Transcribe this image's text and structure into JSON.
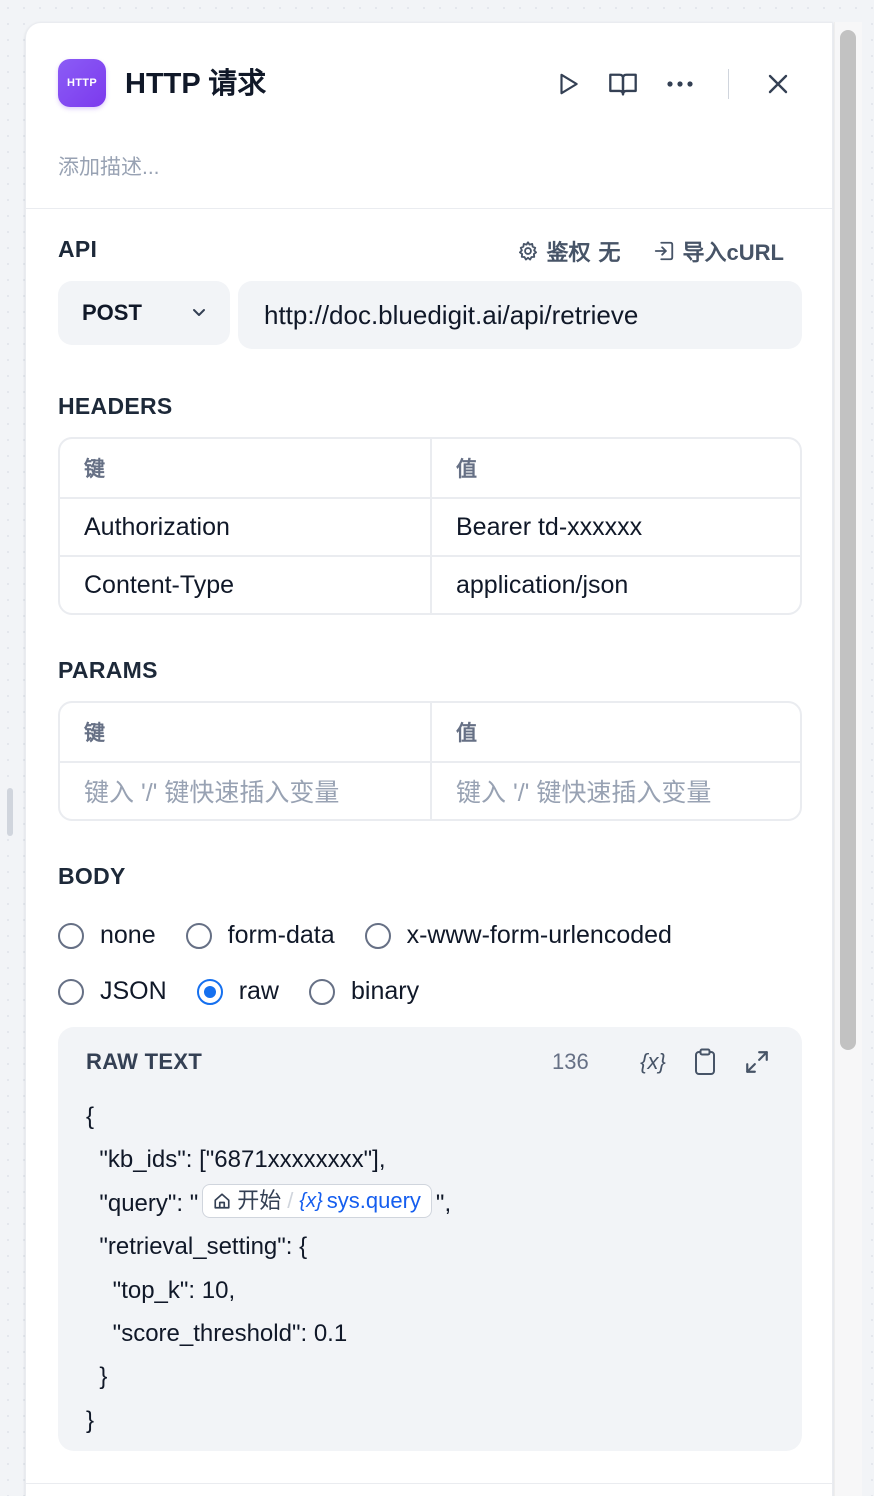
{
  "node": {
    "icon_text": "HTTP",
    "title": "HTTP 请求",
    "description_placeholder": "添加描述..."
  },
  "header_actions": [
    "run-icon",
    "docs-book-icon",
    "more-icon",
    "close-icon"
  ],
  "api": {
    "section_title": "API",
    "auth_label": "鉴权",
    "auth_value": "无",
    "import_curl_label": "导入cURL",
    "method": "POST",
    "url": "http://doc.bluedigit.ai/api/retrieve"
  },
  "headers": {
    "section_title": "HEADERS",
    "key_header": "键",
    "value_header": "值",
    "rows": [
      {
        "key": "Authorization",
        "value": "Bearer td-xxxxxx"
      },
      {
        "key": "Content-Type",
        "value": "application/json"
      }
    ]
  },
  "params": {
    "section_title": "PARAMS",
    "key_header": "键",
    "value_header": "值",
    "key_placeholder": "键入 '/' 键快速插入变量",
    "value_placeholder": "键入 '/' 键快速插入变量"
  },
  "body": {
    "section_title": "BODY",
    "options": [
      "none",
      "form-data",
      "x-www-form-urlencoded",
      "JSON",
      "raw",
      "binary"
    ],
    "selected": "raw",
    "editor": {
      "title": "RAW TEXT",
      "char_count": "136",
      "var_button": "{x}",
      "lines": {
        "l1": "{",
        "l2": "  \"kb_ids\": [\"6871xxxxxxxx\"],",
        "l3_prefix": "  \"query\": \"",
        "l3_suffix": "\",",
        "l4": "  \"retrieval_setting\": {",
        "l5": "    \"top_k\": 10,",
        "l6": "    \"score_threshold\": 0.1",
        "l7": "  }",
        "l8": "}"
      },
      "chip": {
        "node_name": "开始",
        "separator": "/",
        "var_icon": "{x}",
        "var_name": "sys.query"
      }
    }
  },
  "colors": {
    "accent": "#1570ef",
    "node_icon": "#7c3aed",
    "variable": "#155eef"
  }
}
